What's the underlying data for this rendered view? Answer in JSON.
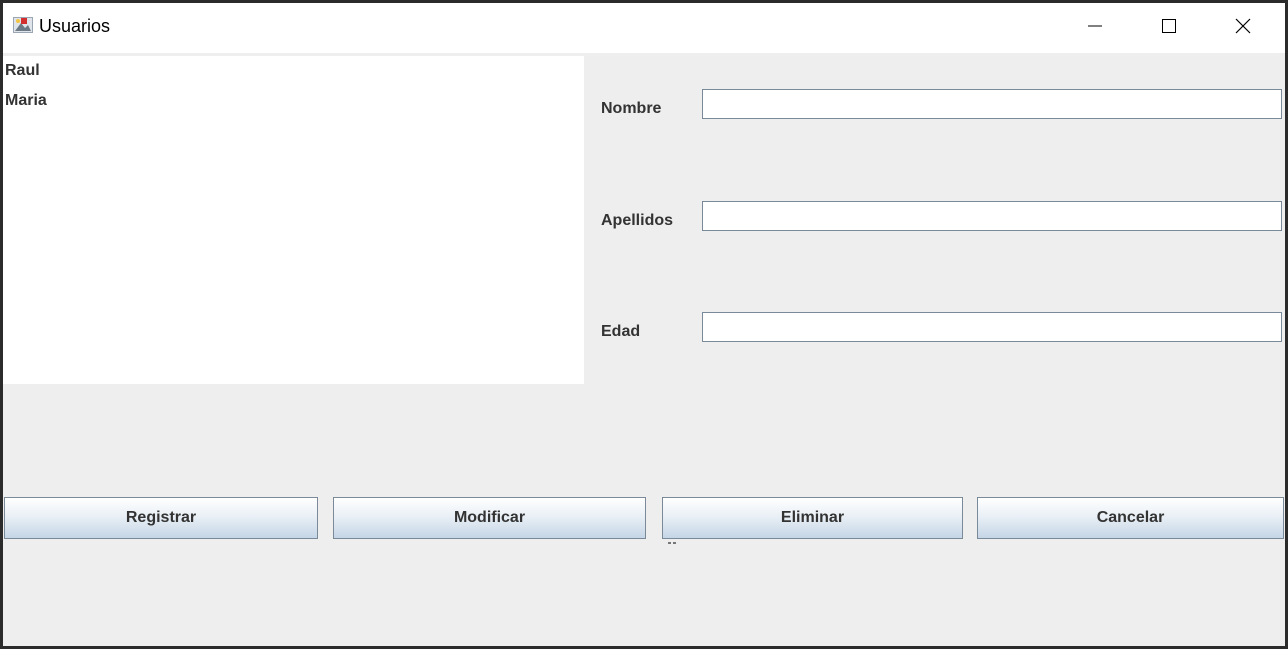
{
  "window": {
    "title": "Usuarios",
    "icon": "java-app-icon",
    "controls": [
      "minimize-icon",
      "maximize-icon",
      "close-icon"
    ]
  },
  "user_list": {
    "items": [
      "Raul",
      "Maria"
    ]
  },
  "form": {
    "nombre": {
      "label": "Nombre",
      "value": ""
    },
    "apellidos": {
      "label": "Apellidos",
      "value": ""
    },
    "edad": {
      "label": "Edad",
      "value": ""
    }
  },
  "buttons": {
    "registrar": "Registrar",
    "modificar": "Modificar",
    "eliminar": "Eliminar",
    "cancelar": "Cancelar"
  },
  "colors": {
    "panel_bg": "#eeeeee",
    "list_bg": "#ffffff",
    "button_gradient_bottom": "#c5d5e6",
    "border": "#7a8a99"
  }
}
